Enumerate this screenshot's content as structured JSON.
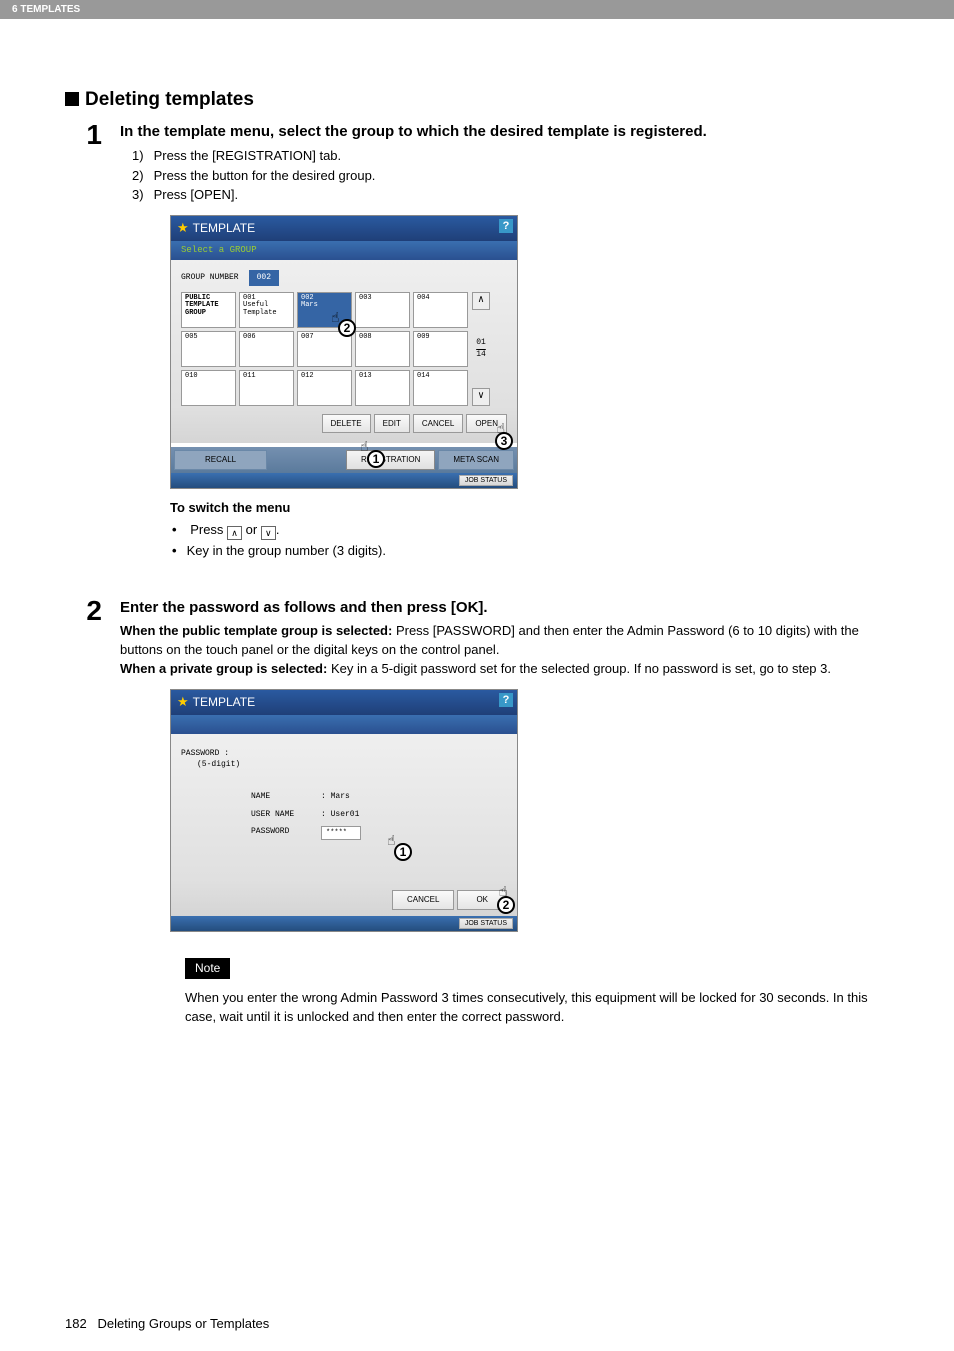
{
  "header": {
    "chapter": "6 TEMPLATES"
  },
  "section": {
    "heading": "Deleting templates"
  },
  "step1": {
    "title": "In the template menu, select the group to which the desired template is registered.",
    "items": [
      "Press the [REGISTRATION] tab.",
      "Press the button for the desired group.",
      "Press [OPEN]."
    ]
  },
  "ui1": {
    "title": "TEMPLATE",
    "subtitle": "Select a GROUP",
    "group_number_label": "GROUP NUMBER",
    "group_number_value": "002",
    "cells": [
      {
        "num": "",
        "label": "PUBLIC TEMPLATE GROUP",
        "hdr": true
      },
      {
        "num": "001",
        "label": "Useful Template"
      },
      {
        "num": "002",
        "label": "Mars",
        "sel": true
      },
      {
        "num": "003",
        "label": ""
      },
      {
        "num": "004",
        "label": ""
      },
      {
        "num": "005",
        "label": ""
      },
      {
        "num": "006",
        "label": ""
      },
      {
        "num": "007",
        "label": ""
      },
      {
        "num": "008",
        "label": ""
      },
      {
        "num": "009",
        "label": ""
      },
      {
        "num": "010",
        "label": ""
      },
      {
        "num": "011",
        "label": ""
      },
      {
        "num": "012",
        "label": ""
      },
      {
        "num": "013",
        "label": ""
      },
      {
        "num": "014",
        "label": ""
      }
    ],
    "page_indicator": {
      "cur": "01",
      "total": "14"
    },
    "buttons": {
      "delete": "DELETE",
      "edit": "EDIT",
      "cancel": "CANCEL",
      "open": "OPEN"
    },
    "tabs": {
      "recall": "RECALL",
      "registration": "REGISTRATION",
      "meta_scan": "META SCAN"
    },
    "job_status": "JOB STATUS"
  },
  "switch": {
    "title": "To switch the menu",
    "line_before": "Press ",
    "line_or": " or ",
    "line_after": ".",
    "line2": "Key in the group number (3 digits)."
  },
  "step2": {
    "title": "Enter the password as follows and then press [OK].",
    "public_prefix": "When the public template group is selected:",
    "public_text": " Press [PASSWORD] and then enter the Admin Password (6 to 10 digits) with the buttons on the touch panel or the digital keys on the control panel.",
    "private_prefix": "When a private group is selected:",
    "private_text": " Key in a 5-digit password set for the selected group. If no password is set, go to step 3."
  },
  "ui2": {
    "title": "TEMPLATE",
    "password_label": "PASSWORD :",
    "password_hint": "(5-digit)",
    "fields": {
      "name_key": "NAME",
      "name_val": ": Mars",
      "user_key": "USER NAME",
      "user_val": ": User01",
      "pwd_key": "PASSWORD",
      "pwd_val": "*****"
    },
    "buttons": {
      "cancel": "CANCEL",
      "ok": "OK"
    },
    "job_status": "JOB STATUS"
  },
  "note": {
    "label": "Note",
    "text": "When you enter the wrong Admin Password 3 times consecutively, this equipment will be locked for 30 seconds. In this case, wait until it is unlocked and then enter the correct password."
  },
  "footer": {
    "page": "182",
    "text": "Deleting Groups or Templates"
  }
}
